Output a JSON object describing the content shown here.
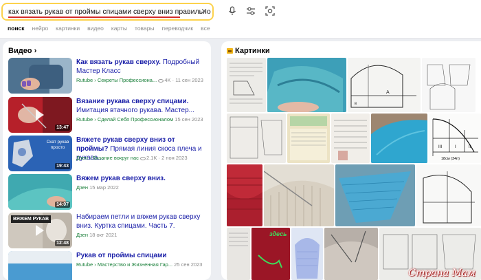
{
  "search": {
    "query": "как вязать рукав от проймы спицами сверху вниз правильно",
    "clear_symbol": "×"
  },
  "tabs": [
    {
      "label": "поиск",
      "active": true
    },
    {
      "label": "нейро"
    },
    {
      "label": "картинки"
    },
    {
      "label": "видео"
    },
    {
      "label": "карты"
    },
    {
      "label": "товары"
    },
    {
      "label": "переводчик"
    },
    {
      "label": "все"
    }
  ],
  "video": {
    "title": "Видео",
    "items": [
      {
        "t1": "Как вязать рукав сверху.",
        "t2": " Подробный Мастер Класс",
        "src": "Rutube › Секреты Профессиона...",
        "views": "4K",
        "date": "· 11 сен 2023",
        "duration": ""
      },
      {
        "t1": "Вязание рукава сверху спицами.",
        "t2": " Имитация втачного рукава. Мастер...",
        "src": "Rutube › Сделай Себя Профессионалом",
        "views": "",
        "date": "15 сен 2023",
        "duration": "13:47"
      },
      {
        "t1": "Вяжете рукав сверху вниз от проймы?",
        "t2": " Прямая линия скоса плеча и рукава...",
        "src": "Дзен › Вязание вокруг нас",
        "views": "2.1K",
        "date": "· 2 ноя 2023",
        "duration": "19:43"
      },
      {
        "t1": "Вяжем рукав сверху вниз.",
        "t2": "",
        "src": "Дзен",
        "views": "",
        "date": "15 мар 2022",
        "duration": "14:07"
      },
      {
        "t1": "Набираем петли и вяжем рукав сверху вниз.",
        "t2": " Куртка спицами. Часть 7.",
        "src": "Дзен",
        "views": "",
        "date": "18 окт 2021",
        "duration": "12:48"
      },
      {
        "t1": "Рукав от проймы спицами",
        "t2": "",
        "src": "Rutube › Мастерство и Жизненная Гар...",
        "views": "",
        "date": "25 сен 2023",
        "duration": ""
      }
    ],
    "thumb_overlay": {
      "item3": "Скат рукав просто",
      "item5": "ВЯЖЕМ РУКАВ"
    }
  },
  "images": {
    "title": "Картинки",
    "watermark": "Страна Мам",
    "overlay_word": "здесь",
    "pattern_labels": [
      "III",
      "I",
      "II",
      "I",
      "18см (34п)"
    ]
  },
  "colors": {
    "search_border": "#fcd24c",
    "link": "#1a1fa8",
    "source": "#1a7f3a",
    "underline": "#d32b2b"
  }
}
